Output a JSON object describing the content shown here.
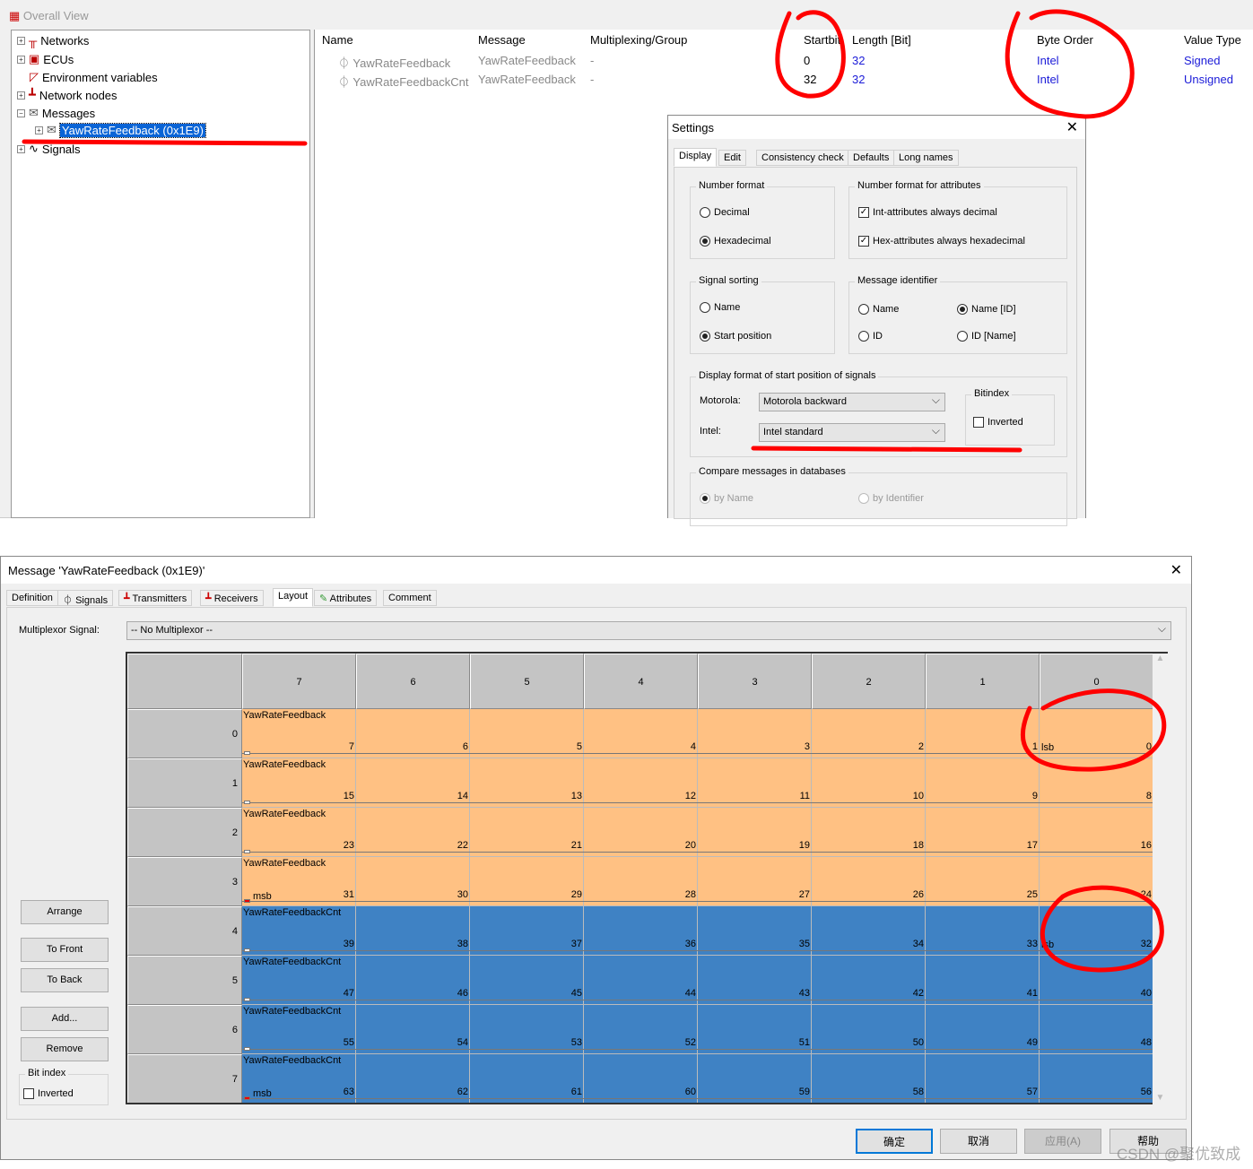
{
  "overall": {
    "title": "Overall View",
    "tree": [
      {
        "label": "Networks",
        "icon": "network-icon"
      },
      {
        "label": "ECUs",
        "icon": "ecu-icon"
      },
      {
        "label": "Environment variables",
        "icon": "gauge-icon"
      },
      {
        "label": "Network nodes",
        "icon": "node-icon"
      },
      {
        "label": "Messages",
        "icon": "envelope-icon"
      },
      {
        "label": "YawRateFeedback (0x1E9)",
        "icon": "envelope-icon"
      },
      {
        "label": "Signals",
        "icon": "signal-wave-icon"
      }
    ]
  },
  "signal_list": {
    "columns": [
      "Name",
      "Message",
      "Multiplexing/Group",
      "Startbit",
      "Length [Bit]",
      "Byte Order",
      "Value Type"
    ],
    "rows": [
      [
        "YawRateFeedback",
        "YawRateFeedback",
        "-",
        "0",
        "32",
        "Intel",
        "Signed"
      ],
      [
        "YawRateFeedbackCnt",
        "YawRateFeedback",
        "-",
        "32",
        "32",
        "Intel",
        "Unsigned"
      ]
    ]
  },
  "settings": {
    "title": "Settings",
    "tabs": [
      "Display",
      "Edit",
      "Consistency check",
      "Defaults",
      "Long names"
    ],
    "number_format": {
      "label": "Number format",
      "decimal": "Decimal",
      "hex": "Hexadecimal",
      "selected": "Hexadecimal"
    },
    "attr_format": {
      "label": "Number format for attributes",
      "int_dec": "Int-attributes always decimal",
      "hex_hex": "Hex-attributes always hexadecimal"
    },
    "signal_sorting": {
      "label": "Signal sorting",
      "name": "Name",
      "start": "Start position",
      "selected": "Start position"
    },
    "msg_id": {
      "label": "Message identifier",
      "name": "Name",
      "name_id": "Name [ID]",
      "id": "ID",
      "id_name": "ID [Name]",
      "selected": "Name [ID]"
    },
    "start_pos": {
      "label": "Display format of start position of signals",
      "motorola_label": "Motorola:",
      "motorola_value": "Motorola backward",
      "intel_label": "Intel:",
      "intel_value": "Intel standard",
      "bitindex": "Bitindex",
      "inverted": "Inverted"
    },
    "compare": {
      "label": "Compare messages in databases",
      "by_name": "by Name",
      "by_id": "by Identifier"
    }
  },
  "message_dialog": {
    "title": "Message 'YawRateFeedback (0x1E9)'",
    "tabs": [
      "Definition",
      "Signals",
      "Transmitters",
      "Receivers",
      "Layout",
      "Attributes",
      "Comment"
    ],
    "active_tab": "Layout",
    "multiplexor_label": "Multiplexor Signal:",
    "multiplexor_value": "-- No Multiplexor --",
    "buttons": {
      "arrange": "Arrange",
      "to_front": "To Front",
      "to_back": "To Back",
      "add": "Add...",
      "remove": "Remove"
    },
    "bitindex": {
      "label": "Bit index",
      "inverted": "Inverted"
    },
    "footer": {
      "ok": "确定",
      "cancel": "取消",
      "apply": "应用(A)",
      "help": "帮助"
    },
    "colors": {
      "YawRateFeedback": "#ffc183",
      "YawRateFeedbackCnt": "#3f82c4"
    },
    "columns": [
      "7",
      "6",
      "5",
      "4",
      "3",
      "2",
      "1",
      "0"
    ],
    "rows": [
      {
        "byte": "0",
        "signal": "YawRateFeedback",
        "bits": [
          "7",
          "6",
          "5",
          "4",
          "3",
          "2",
          "1",
          "0"
        ],
        "marker": "lsb"
      },
      {
        "byte": "1",
        "signal": "YawRateFeedback",
        "bits": [
          "15",
          "14",
          "13",
          "12",
          "11",
          "10",
          "9",
          "8"
        ]
      },
      {
        "byte": "2",
        "signal": "YawRateFeedback",
        "bits": [
          "23",
          "22",
          "21",
          "20",
          "19",
          "18",
          "17",
          "16"
        ]
      },
      {
        "byte": "3",
        "signal": "YawRateFeedback",
        "bits": [
          "31",
          "30",
          "29",
          "28",
          "27",
          "26",
          "25",
          "24"
        ],
        "marker": "msb"
      },
      {
        "byte": "4",
        "signal": "YawRateFeedbackCnt",
        "bits": [
          "39",
          "38",
          "37",
          "36",
          "35",
          "34",
          "33",
          "32"
        ],
        "marker": "lsb"
      },
      {
        "byte": "5",
        "signal": "YawRateFeedbackCnt",
        "bits": [
          "47",
          "46",
          "45",
          "44",
          "43",
          "42",
          "41",
          "40"
        ]
      },
      {
        "byte": "6",
        "signal": "YawRateFeedbackCnt",
        "bits": [
          "55",
          "54",
          "53",
          "52",
          "51",
          "50",
          "49",
          "48"
        ]
      },
      {
        "byte": "7",
        "signal": "YawRateFeedbackCnt",
        "bits": [
          "63",
          "62",
          "61",
          "60",
          "59",
          "58",
          "57",
          "56"
        ],
        "marker": "msb"
      }
    ]
  },
  "watermark": "CSDN @聚优致成"
}
